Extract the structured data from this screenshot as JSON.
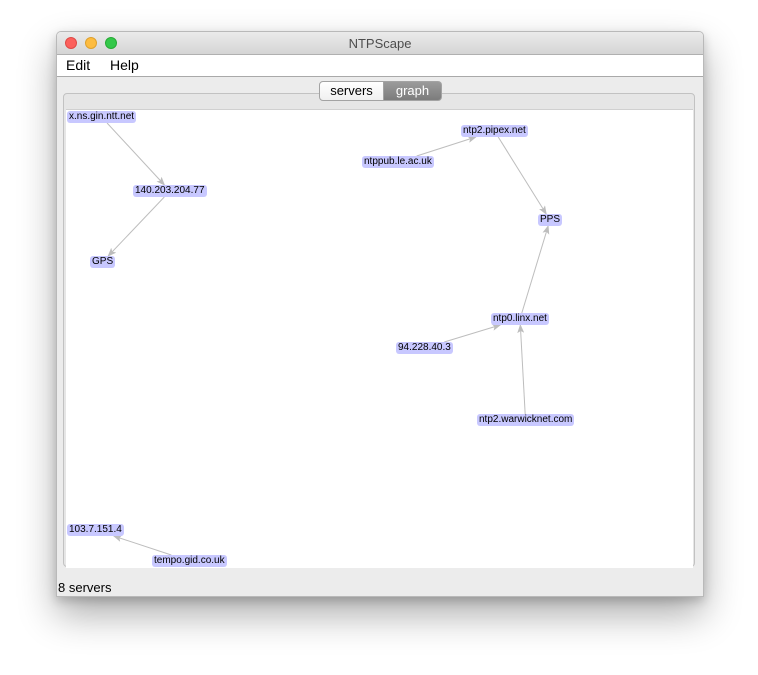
{
  "window": {
    "title": "NTPScape"
  },
  "menu": {
    "items": [
      {
        "label": "Edit"
      },
      {
        "label": "Help"
      }
    ]
  },
  "tabs": {
    "items": [
      {
        "label": "servers",
        "selected": false
      },
      {
        "label": "graph",
        "selected": true
      }
    ]
  },
  "graph": {
    "nodes": [
      {
        "id": "x.ns.gin.ntt.net",
        "label": "x.ns.gin.ntt.net"
      },
      {
        "id": "140.203.204.77",
        "label": "140.203.204.77"
      },
      {
        "id": "GPS",
        "label": "GPS"
      },
      {
        "id": "ntp2.pipex.net",
        "label": "ntp2.pipex.net"
      },
      {
        "id": "ntppub.le.ac.uk",
        "label": "ntppub.le.ac.uk"
      },
      {
        "id": "PPS",
        "label": "PPS"
      },
      {
        "id": "ntp0.linx.net",
        "label": "ntp0.linx.net"
      },
      {
        "id": "94.228.40.3",
        "label": "94.228.40.3"
      },
      {
        "id": "ntp2.warwicknet.com",
        "label": "ntp2.warwicknet.com"
      },
      {
        "id": "103.7.151.4",
        "label": "103.7.151.4"
      },
      {
        "id": "tempo.gid.co.uk",
        "label": "tempo.gid.co.uk"
      }
    ],
    "edges": [
      {
        "from": "x.ns.gin.ntt.net",
        "to": "140.203.204.77"
      },
      {
        "from": "140.203.204.77",
        "to": "GPS"
      },
      {
        "from": "ntppub.le.ac.uk",
        "to": "ntp2.pipex.net"
      },
      {
        "from": "ntp2.pipex.net",
        "to": "PPS"
      },
      {
        "from": "ntp0.linx.net",
        "to": "PPS"
      },
      {
        "from": "94.228.40.3",
        "to": "ntp0.linx.net"
      },
      {
        "from": "ntp2.warwicknet.com",
        "to": "ntp0.linx.net"
      },
      {
        "from": "tempo.gid.co.uk",
        "to": "103.7.151.4"
      }
    ],
    "colors": {
      "node_fill": "#c8c8ff",
      "edge": "#bdbdbd"
    }
  },
  "status": {
    "text": "8 servers"
  }
}
